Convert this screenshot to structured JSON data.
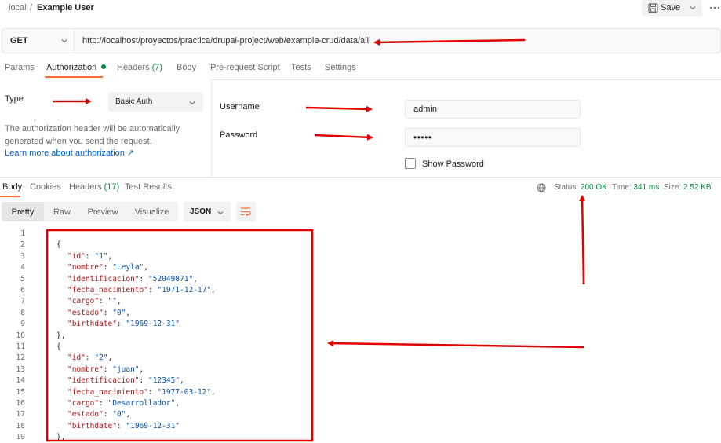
{
  "header": {
    "workspace": "local",
    "separator": "/",
    "request_name": "Example User",
    "save_label": "Save"
  },
  "request": {
    "method": "GET",
    "url": "http://localhost/proyectos/practica/drupal-project/web/example-crud/data/all"
  },
  "request_tabs": [
    {
      "label": "Params",
      "count": ""
    },
    {
      "label": "Authorization",
      "count": ""
    },
    {
      "label": "Headers",
      "count": "(7)"
    },
    {
      "label": "Body",
      "count": ""
    },
    {
      "label": "Pre-request Script",
      "count": ""
    },
    {
      "label": "Tests",
      "count": ""
    },
    {
      "label": "Settings",
      "count": ""
    }
  ],
  "auth": {
    "type_label": "Type",
    "type_value": "Basic Auth",
    "help_line1": "The authorization header will be automatically",
    "help_line2": "generated when you send the request.",
    "learn_more": "Learn more about authorization ↗",
    "username_label": "Username",
    "username_value": "admin",
    "password_label": "Password",
    "password_value": "•••••",
    "show_password_label": "Show Password"
  },
  "response_tabs": [
    {
      "label": "Body",
      "count": ""
    },
    {
      "label": "Cookies",
      "count": ""
    },
    {
      "label": "Headers",
      "count": "(17)"
    },
    {
      "label": "Test Results",
      "count": ""
    }
  ],
  "status": {
    "status_label": "Status:",
    "status_value": "200 OK",
    "time_label": "Time:",
    "time_value": "341 ms",
    "size_label": "Size:",
    "size_value": "2.52 KB"
  },
  "view_modes": [
    "Pretty",
    "Raw",
    "Preview",
    "Visualize"
  ],
  "format": "JSON",
  "code_lines": [
    {
      "n": "1",
      "indent": 0,
      "text": "["
    },
    {
      "n": "2",
      "indent": 1,
      "text": "{"
    },
    {
      "n": "3",
      "indent": 2,
      "key": "\"id\"",
      "value": "\"1\"",
      "trail": ","
    },
    {
      "n": "4",
      "indent": 2,
      "key": "\"nombre\"",
      "value": "\"Leyla\"",
      "trail": ","
    },
    {
      "n": "5",
      "indent": 2,
      "key": "\"identificacion\"",
      "value": "\"52049871\"",
      "trail": ","
    },
    {
      "n": "6",
      "indent": 2,
      "key": "\"fecha_nacimiento\"",
      "value": "\"1971-12-17\"",
      "trail": ","
    },
    {
      "n": "7",
      "indent": 2,
      "key": "\"cargo\"",
      "value": "\"\"",
      "trail": ","
    },
    {
      "n": "8",
      "indent": 2,
      "key": "\"estado\"",
      "value": "\"0\"",
      "trail": ","
    },
    {
      "n": "9",
      "indent": 2,
      "key": "\"birthdate\"",
      "value": "\"1969-12-31\"",
      "trail": ""
    },
    {
      "n": "10",
      "indent": 1,
      "text": "},"
    },
    {
      "n": "11",
      "indent": 1,
      "text": "{"
    },
    {
      "n": "12",
      "indent": 2,
      "key": "\"id\"",
      "value": "\"2\"",
      "trail": ","
    },
    {
      "n": "13",
      "indent": 2,
      "key": "\"nombre\"",
      "value": "\"juan\"",
      "trail": ","
    },
    {
      "n": "14",
      "indent": 2,
      "key": "\"identificacion\"",
      "value": "\"12345\"",
      "trail": ","
    },
    {
      "n": "15",
      "indent": 2,
      "key": "\"fecha_nacimiento\"",
      "value": "\"1977-03-12\"",
      "trail": ","
    },
    {
      "n": "16",
      "indent": 2,
      "key": "\"cargo\"",
      "value": "\"Desarrollador\"",
      "trail": ","
    },
    {
      "n": "17",
      "indent": 2,
      "key": "\"estado\"",
      "value": "\"0\"",
      "trail": ","
    },
    {
      "n": "18",
      "indent": 2,
      "key": "\"birthdate\"",
      "value": "\"1969-12-31\"",
      "trail": ""
    },
    {
      "n": "19",
      "indent": 1,
      "text": "},"
    }
  ],
  "icons": {
    "save": "save-icon",
    "more": "more-horizontal-icon",
    "chevron": "chevron-down-icon",
    "globe": "globe-icon",
    "wrap": "wrap-lines-icon"
  },
  "colors": {
    "accent": "#ff6c37",
    "success": "#0b8a3e",
    "link": "#0265d2",
    "annotation": "#e00000"
  }
}
